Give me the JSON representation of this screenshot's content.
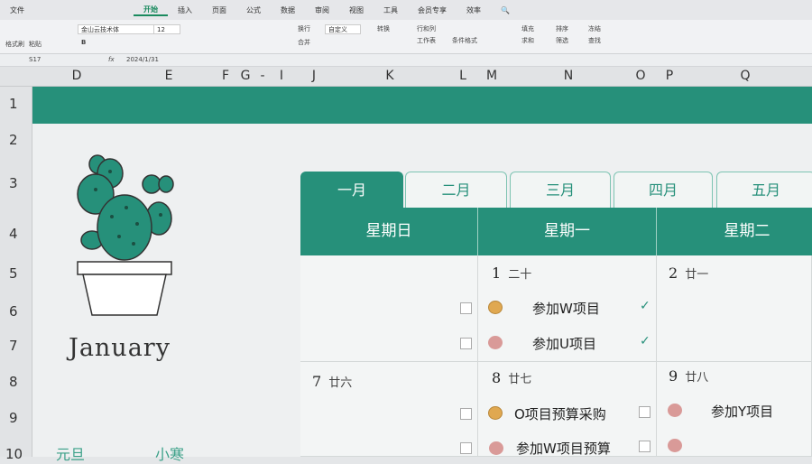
{
  "menu": {
    "file": "文件",
    "tabs": [
      "开始",
      "插入",
      "页面",
      "公式",
      "数据",
      "审阅",
      "视图",
      "工具",
      "会员专享",
      "效率"
    ],
    "active_tab": "开始"
  },
  "ribbon": {
    "format_painter": "格式刷",
    "paste": "粘贴",
    "font_name": "金山云技术体",
    "font_size": "12",
    "wrap": "换行",
    "merge": "合并",
    "number_format": "自定义",
    "convert": "转换",
    "rows_cols": "行和列",
    "worksheet": "工作表",
    "cond_format": "条件格式",
    "fill": "填充",
    "sort": "排序",
    "freeze": "冻结",
    "sum": "求和",
    "filter": "筛选",
    "find": "查找"
  },
  "formula_bar": {
    "cell_ref": "S17",
    "fx": "fx",
    "value": "2024/1/31"
  },
  "columns": [
    "D",
    "E",
    "F",
    "G",
    "-",
    "I",
    "J",
    "K",
    "L",
    "M",
    "N",
    "O",
    "P",
    "Q"
  ],
  "rows": [
    "1",
    "2",
    "3",
    "4",
    "5",
    "6",
    "7",
    "8",
    "9",
    "10"
  ],
  "calendar": {
    "month_title": "January",
    "month_tabs": [
      "一月",
      "二月",
      "三月",
      "四月",
      "五月"
    ],
    "active_tab": "一月",
    "weekdays": [
      "星期日",
      "星期一",
      "星期二"
    ],
    "days": [
      {
        "num": "1",
        "lunar": "二十"
      },
      {
        "num": "2",
        "lunar": "廿一"
      },
      {
        "num": "7",
        "lunar": "廿六"
      },
      {
        "num": "8",
        "lunar": "廿七"
      },
      {
        "num": "9",
        "lunar": "廿八"
      }
    ],
    "tasks": [
      {
        "text": "参加W项目",
        "done": "✓",
        "color": "#e0a850"
      },
      {
        "text": "参加U项目",
        "done": "✓",
        "color": "#d99a98"
      },
      {
        "text": "O项目预算采购",
        "color": "#e0a850"
      },
      {
        "text": "参加W项目预算",
        "color": "#d99a98"
      },
      {
        "text": "参加Y项目",
        "color": "#d99a98"
      }
    ],
    "holidays": [
      "元旦",
      "小寒"
    ]
  },
  "accent": "#26907a"
}
